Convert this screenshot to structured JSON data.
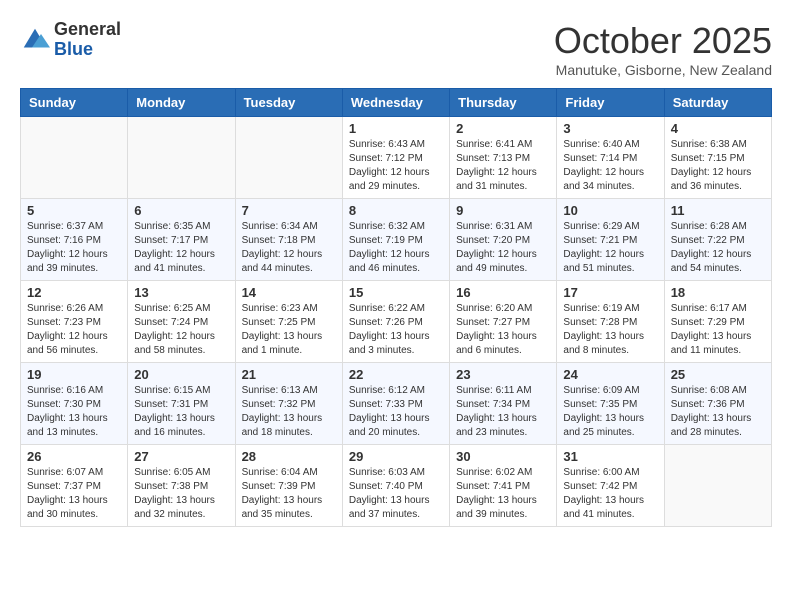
{
  "logo": {
    "general": "General",
    "blue": "Blue"
  },
  "header": {
    "title": "October 2025",
    "subtitle": "Manutuke, Gisborne, New Zealand"
  },
  "weekdays": [
    "Sunday",
    "Monday",
    "Tuesday",
    "Wednesday",
    "Thursday",
    "Friday",
    "Saturday"
  ],
  "weeks": [
    [
      {
        "day": "",
        "info": ""
      },
      {
        "day": "",
        "info": ""
      },
      {
        "day": "",
        "info": ""
      },
      {
        "day": "1",
        "info": "Sunrise: 6:43 AM\nSunset: 7:12 PM\nDaylight: 12 hours and 29 minutes."
      },
      {
        "day": "2",
        "info": "Sunrise: 6:41 AM\nSunset: 7:13 PM\nDaylight: 12 hours and 31 minutes."
      },
      {
        "day": "3",
        "info": "Sunrise: 6:40 AM\nSunset: 7:14 PM\nDaylight: 12 hours and 34 minutes."
      },
      {
        "day": "4",
        "info": "Sunrise: 6:38 AM\nSunset: 7:15 PM\nDaylight: 12 hours and 36 minutes."
      }
    ],
    [
      {
        "day": "5",
        "info": "Sunrise: 6:37 AM\nSunset: 7:16 PM\nDaylight: 12 hours and 39 minutes."
      },
      {
        "day": "6",
        "info": "Sunrise: 6:35 AM\nSunset: 7:17 PM\nDaylight: 12 hours and 41 minutes."
      },
      {
        "day": "7",
        "info": "Sunrise: 6:34 AM\nSunset: 7:18 PM\nDaylight: 12 hours and 44 minutes."
      },
      {
        "day": "8",
        "info": "Sunrise: 6:32 AM\nSunset: 7:19 PM\nDaylight: 12 hours and 46 minutes."
      },
      {
        "day": "9",
        "info": "Sunrise: 6:31 AM\nSunset: 7:20 PM\nDaylight: 12 hours and 49 minutes."
      },
      {
        "day": "10",
        "info": "Sunrise: 6:29 AM\nSunset: 7:21 PM\nDaylight: 12 hours and 51 minutes."
      },
      {
        "day": "11",
        "info": "Sunrise: 6:28 AM\nSunset: 7:22 PM\nDaylight: 12 hours and 54 minutes."
      }
    ],
    [
      {
        "day": "12",
        "info": "Sunrise: 6:26 AM\nSunset: 7:23 PM\nDaylight: 12 hours and 56 minutes."
      },
      {
        "day": "13",
        "info": "Sunrise: 6:25 AM\nSunset: 7:24 PM\nDaylight: 12 hours and 58 minutes."
      },
      {
        "day": "14",
        "info": "Sunrise: 6:23 AM\nSunset: 7:25 PM\nDaylight: 13 hours and 1 minute."
      },
      {
        "day": "15",
        "info": "Sunrise: 6:22 AM\nSunset: 7:26 PM\nDaylight: 13 hours and 3 minutes."
      },
      {
        "day": "16",
        "info": "Sunrise: 6:20 AM\nSunset: 7:27 PM\nDaylight: 13 hours and 6 minutes."
      },
      {
        "day": "17",
        "info": "Sunrise: 6:19 AM\nSunset: 7:28 PM\nDaylight: 13 hours and 8 minutes."
      },
      {
        "day": "18",
        "info": "Sunrise: 6:17 AM\nSunset: 7:29 PM\nDaylight: 13 hours and 11 minutes."
      }
    ],
    [
      {
        "day": "19",
        "info": "Sunrise: 6:16 AM\nSunset: 7:30 PM\nDaylight: 13 hours and 13 minutes."
      },
      {
        "day": "20",
        "info": "Sunrise: 6:15 AM\nSunset: 7:31 PM\nDaylight: 13 hours and 16 minutes."
      },
      {
        "day": "21",
        "info": "Sunrise: 6:13 AM\nSunset: 7:32 PM\nDaylight: 13 hours and 18 minutes."
      },
      {
        "day": "22",
        "info": "Sunrise: 6:12 AM\nSunset: 7:33 PM\nDaylight: 13 hours and 20 minutes."
      },
      {
        "day": "23",
        "info": "Sunrise: 6:11 AM\nSunset: 7:34 PM\nDaylight: 13 hours and 23 minutes."
      },
      {
        "day": "24",
        "info": "Sunrise: 6:09 AM\nSunset: 7:35 PM\nDaylight: 13 hours and 25 minutes."
      },
      {
        "day": "25",
        "info": "Sunrise: 6:08 AM\nSunset: 7:36 PM\nDaylight: 13 hours and 28 minutes."
      }
    ],
    [
      {
        "day": "26",
        "info": "Sunrise: 6:07 AM\nSunset: 7:37 PM\nDaylight: 13 hours and 30 minutes."
      },
      {
        "day": "27",
        "info": "Sunrise: 6:05 AM\nSunset: 7:38 PM\nDaylight: 13 hours and 32 minutes."
      },
      {
        "day": "28",
        "info": "Sunrise: 6:04 AM\nSunset: 7:39 PM\nDaylight: 13 hours and 35 minutes."
      },
      {
        "day": "29",
        "info": "Sunrise: 6:03 AM\nSunset: 7:40 PM\nDaylight: 13 hours and 37 minutes."
      },
      {
        "day": "30",
        "info": "Sunrise: 6:02 AM\nSunset: 7:41 PM\nDaylight: 13 hours and 39 minutes."
      },
      {
        "day": "31",
        "info": "Sunrise: 6:00 AM\nSunset: 7:42 PM\nDaylight: 13 hours and 41 minutes."
      },
      {
        "day": "",
        "info": ""
      }
    ]
  ]
}
